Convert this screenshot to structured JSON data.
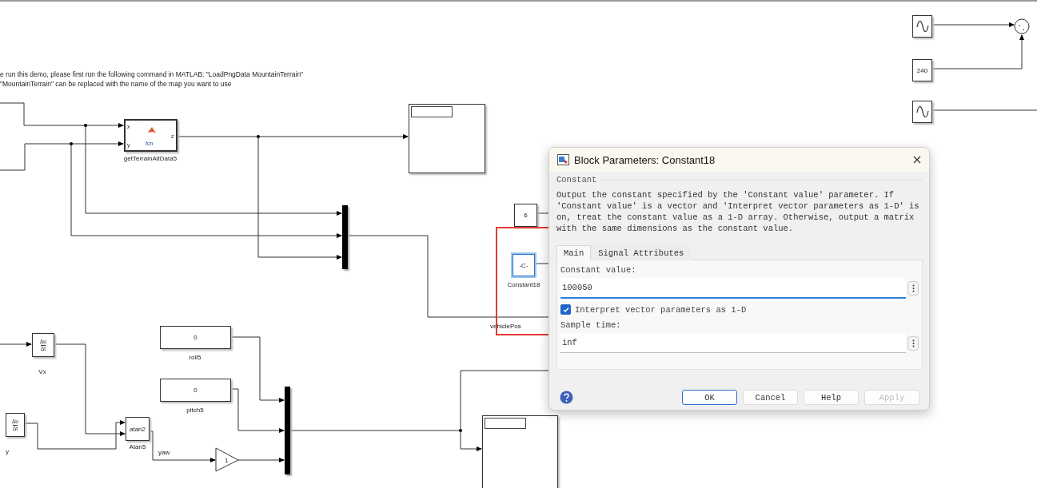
{
  "diagram": {
    "annotation": [
      "e run this demo, please first run the following command in MATLAB: \"LoadPngData MountainTerrain\"",
      "\"MountainTerrain\" can be replaced with the name of the map you want to use"
    ],
    "terrain_block": {
      "body": "fcn",
      "inputs": [
        "x",
        "y"
      ],
      "output": "z",
      "label": "getTerrainAltData5"
    },
    "constants": [
      {
        "value": "6",
        "selected": false
      },
      {
        "value": "-C-",
        "label": "Constant18",
        "selected": true
      },
      {
        "value": "0",
        "label": "roll5",
        "selected": false
      },
      {
        "value": "0",
        "label": "pitch5",
        "selected": false
      },
      {
        "value": "240",
        "selected": false
      }
    ],
    "derivatives": [
      {
        "numerator": "Δu",
        "denominator": "Δt",
        "label": "Vx"
      },
      {
        "numerator": "Δu",
        "denominator": "Δt",
        "label": "y"
      }
    ],
    "atan_block": {
      "body": "atan2",
      "label": "Atan5"
    },
    "gain_block": {
      "value": "1"
    },
    "signal_labels": [
      "vehiclePos",
      "yaw"
    ]
  },
  "dialog": {
    "title": "Block Parameters: Constant18",
    "group": "Constant",
    "description": "Output the constant specified by the 'Constant value' parameter. If 'Constant value' is a vector and 'Interpret vector parameters as 1-D' is on, treat the constant value as a 1-D array. Otherwise, output a matrix with the same dimensions as the constant value.",
    "tabs": [
      {
        "label": "Main",
        "selected": true
      },
      {
        "label": "Signal Attributes",
        "selected": false
      }
    ],
    "constant_value": {
      "label": "Constant value:",
      "value": "100050",
      "focused": true
    },
    "interpret_vector": {
      "label": "Interpret vector parameters as 1-D",
      "checked": true
    },
    "sample_time": {
      "label": "Sample time:",
      "value": "inf",
      "focused": false
    },
    "buttons": [
      {
        "label": "OK",
        "default": true,
        "disabled": false
      },
      {
        "label": "Cancel",
        "default": false,
        "disabled": false
      },
      {
        "label": "Help",
        "default": false,
        "disabled": false
      },
      {
        "label": "Apply",
        "default": false,
        "disabled": true
      }
    ]
  }
}
